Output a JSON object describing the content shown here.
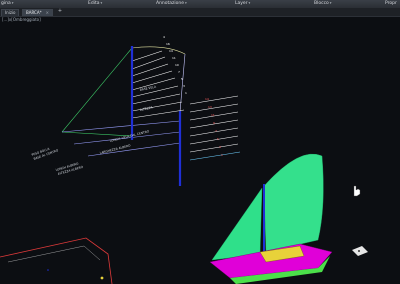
{
  "menus": [
    {
      "label": "gina"
    },
    {
      "label": "Edita"
    },
    {
      "label": "Annotazione"
    },
    {
      "label": "Layer"
    },
    {
      "label": "Blocco"
    },
    {
      "label": "Propr"
    }
  ],
  "tabs": [
    {
      "label": "Inizio"
    },
    {
      "label": "BARCA*"
    }
  ],
  "tab_add": "+",
  "tab_close": "×",
  "menu_arrow": "▾",
  "viewport_label": "[...]x[Ombreggiato]",
  "colors": {
    "background": "#0c0e12",
    "sail_green": "#2fe08a",
    "hull_magenta": "#e000d8",
    "hull_green": "#4be04a",
    "deck_yellow": "#e8d23a",
    "mast_blue": "#1f2fd6",
    "hull_frame_red": "#e03a3a"
  },
  "drawing_labels": {
    "top_scale": [
      "4",
      "16",
      "14",
      "11",
      "10",
      "7",
      "5",
      "3",
      "1"
    ],
    "right_scale": [
      "14",
      "13",
      "11",
      "9",
      "7",
      "5",
      "3",
      "1"
    ],
    "left_a": [
      "PESO BOLLA",
      "BASE AL CENTRO"
    ],
    "left_b": [
      "LUNGH ALBERO",
      "ALTEZZA ALBERO"
    ],
    "mid": [
      "LARGHEZZA ALBERO",
      "LUNGH. VELA DAL CENTRO"
    ],
    "upper": [
      "BASE VELA",
      "ALTEZZA"
    ]
  },
  "cursor_icon": "hand-pointer-icon"
}
